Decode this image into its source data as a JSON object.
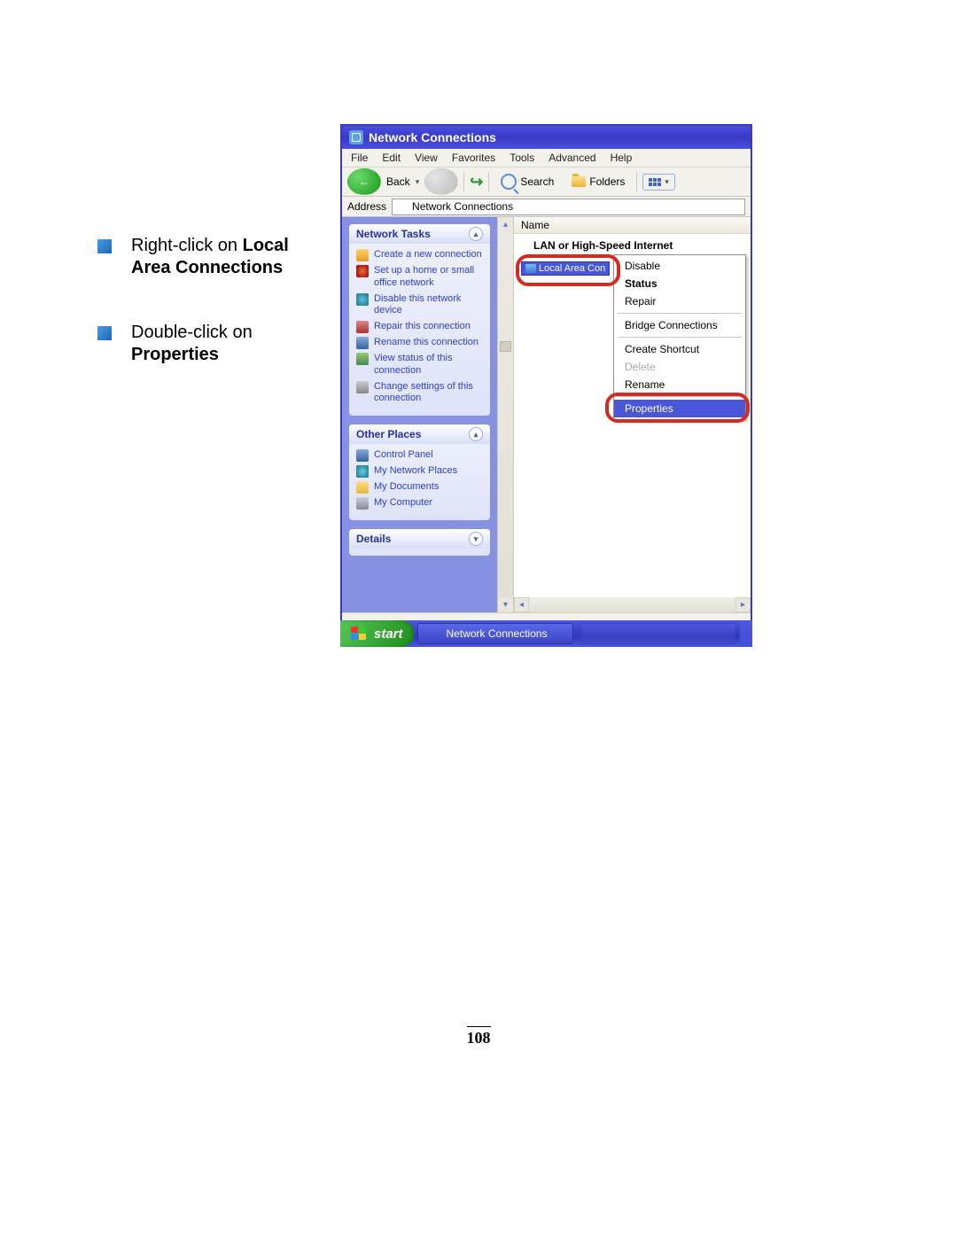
{
  "page_number": "108",
  "instructions": [
    {
      "pre": "Right-click on ",
      "bold": "Local Area Connections"
    },
    {
      "pre": "Double-click on ",
      "bold": "Properties"
    }
  ],
  "window": {
    "title": "Network Connections",
    "menu": [
      "File",
      "Edit",
      "View",
      "Favorites",
      "Tools",
      "Advanced",
      "Help"
    ],
    "toolbar": {
      "back": "Back",
      "search": "Search",
      "folders": "Folders"
    },
    "address_label": "Address",
    "address_value": "Network Connections",
    "columns": {
      "name": "Name"
    },
    "group_title": "LAN or High-Speed Internet",
    "item_label": "Local Area Con",
    "sidepanel": {
      "network_tasks": {
        "title": "Network Tasks",
        "items": [
          "Create a new connection",
          "Set up a home or small office network",
          "Disable this network device",
          "Repair this connection",
          "Rename this connection",
          "View status of this connection",
          "Change settings of this connection"
        ]
      },
      "other_places": {
        "title": "Other Places",
        "items": [
          "Control Panel",
          "My Network Places",
          "My Documents",
          "My Computer"
        ]
      },
      "details": {
        "title": "Details"
      }
    },
    "context_menu": {
      "items": [
        {
          "label": "Disable"
        },
        {
          "label": "Status",
          "bold": true
        },
        {
          "label": "Repair"
        },
        {
          "sep": true
        },
        {
          "label": "Bridge Connections"
        },
        {
          "sep": true
        },
        {
          "label": "Create Shortcut"
        },
        {
          "label": "Delete",
          "disabled": true
        },
        {
          "label": "Rename"
        },
        {
          "sep": true
        },
        {
          "label": "Properties",
          "selected": true
        }
      ]
    },
    "taskbar": {
      "start": "start",
      "task": "Network Connections"
    }
  }
}
